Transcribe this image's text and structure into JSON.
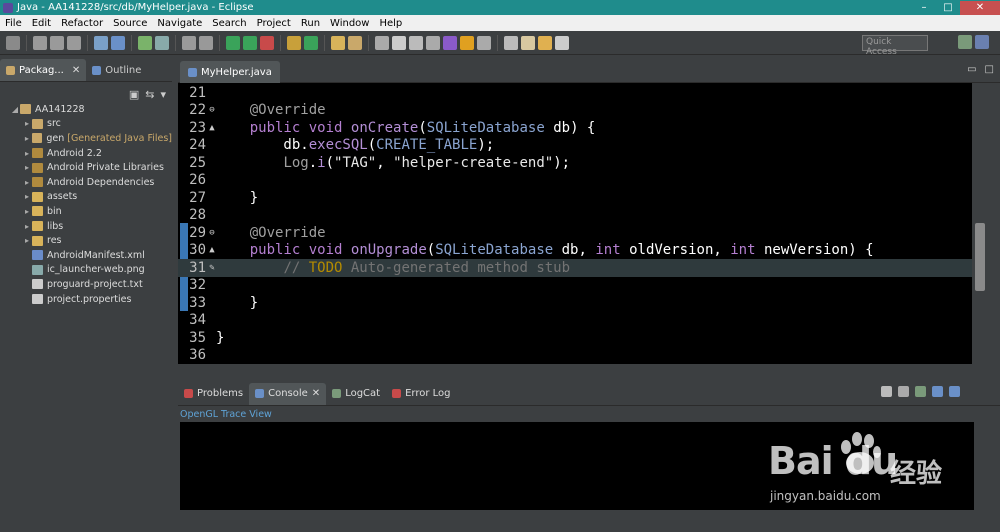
{
  "window": {
    "title": "Java - AA141228/src/db/MyHelper.java - Eclipse",
    "minimize": "–",
    "maximize": "□",
    "close": "✕"
  },
  "menu": [
    "File",
    "Edit",
    "Refactor",
    "Source",
    "Navigate",
    "Search",
    "Project",
    "Run",
    "Window",
    "Help"
  ],
  "quick_access": {
    "placeholder": "Quick Access"
  },
  "left_panel": {
    "tabs": [
      {
        "label": "Packag...",
        "active": true
      },
      {
        "label": "Outline",
        "active": false
      }
    ],
    "tree": {
      "root": "AA141228",
      "items": [
        {
          "label": "src",
          "icon": "package-folder-icon",
          "color": "#c9a86a"
        },
        {
          "label": "gen",
          "note": "[Generated Java Files]",
          "icon": "package-folder-icon",
          "color": "#c9a86a"
        },
        {
          "label": "Android 2.2",
          "icon": "library-icon",
          "color": "#b08a3e"
        },
        {
          "label": "Android Private Libraries",
          "icon": "library-icon",
          "color": "#b08a3e"
        },
        {
          "label": "Android Dependencies",
          "icon": "library-icon",
          "color": "#b08a3e"
        },
        {
          "label": "assets",
          "icon": "folder-icon",
          "color": "#d8b35a"
        },
        {
          "label": "bin",
          "icon": "folder-icon",
          "color": "#d8b35a"
        },
        {
          "label": "libs",
          "icon": "folder-icon",
          "color": "#d8b35a"
        },
        {
          "label": "res",
          "icon": "folder-icon",
          "color": "#d8b35a"
        },
        {
          "label": "AndroidManifest.xml",
          "icon": "xml-file-icon",
          "color": "#6a8cc9"
        },
        {
          "label": "ic_launcher-web.png",
          "icon": "image-file-icon",
          "color": "#8aa"
        },
        {
          "label": "proguard-project.txt",
          "icon": "text-file-icon",
          "color": "#ccc"
        },
        {
          "label": "project.properties",
          "icon": "properties-file-icon",
          "color": "#ccc"
        }
      ]
    }
  },
  "editor": {
    "tab": "MyHelper.java",
    "lines": [
      {
        "num": "21",
        "code": ""
      },
      {
        "num": "22",
        "marker": "⊖",
        "code": "    @Override"
      },
      {
        "num": "23",
        "marker": "▲",
        "code": "    public void onCreate(SQLiteDatabase db) {"
      },
      {
        "num": "24",
        "code": "        db.execSQL(CREATE_TABLE);"
      },
      {
        "num": "25",
        "code": "        Log.i(\"TAG\", \"helper-create-end\");"
      },
      {
        "num": "26",
        "code": ""
      },
      {
        "num": "27",
        "code": "    }"
      },
      {
        "num": "28",
        "code": ""
      },
      {
        "num": "29",
        "marker": "⊖",
        "code": "    @Override"
      },
      {
        "num": "30",
        "marker": "▲",
        "code": "    public void onUpgrade(SQLiteDatabase db, int oldVersion, int newVersion) {"
      },
      {
        "num": "31",
        "marker": "✎",
        "code": "        // TODO Auto-generated method stub"
      },
      {
        "num": "32",
        "code": ""
      },
      {
        "num": "33",
        "code": "    }"
      },
      {
        "num": "34",
        "code": ""
      },
      {
        "num": "35",
        "code": "}"
      },
      {
        "num": "36",
        "code": ""
      }
    ],
    "highlighted_line": "31"
  },
  "bottom_panel": {
    "tabs": [
      {
        "label": "Problems",
        "active": false
      },
      {
        "label": "Console",
        "active": true
      },
      {
        "label": "LogCat",
        "active": false
      },
      {
        "label": "Error Log",
        "active": false
      }
    ],
    "console_title": "OpenGL Trace View"
  },
  "watermark": {
    "brand": "Bai du",
    "chinese": "经验",
    "url": "jingyan.baidu.com"
  },
  "colors": {
    "titlebar": "#1f8c8c",
    "editor_bg": "#000000",
    "panel_bg": "#3c3f41"
  }
}
